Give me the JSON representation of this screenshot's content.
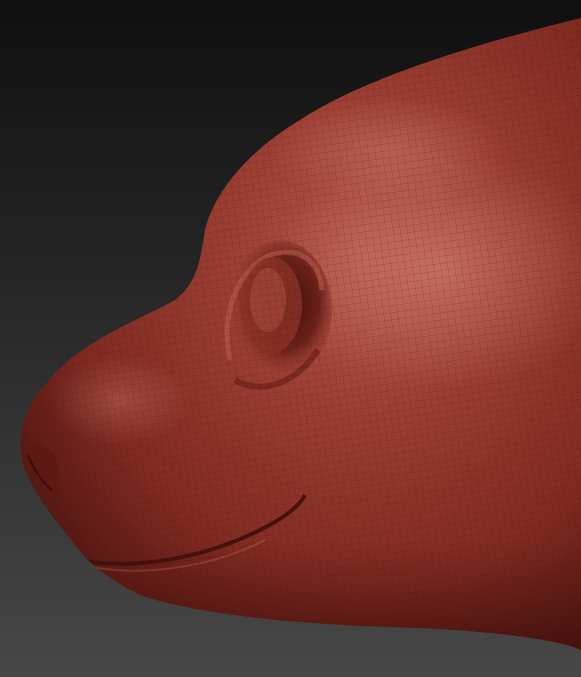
{
  "viewport": {
    "background_top": "#0f0f0f",
    "background_bottom": "#474747",
    "material_base": "#8a2f26",
    "material_highlight": "#c46a5e",
    "material_shadow": "#4a140f",
    "wireframe_color": "#5a1a14"
  },
  "model": {
    "subject": "animal-head-sculpt",
    "view": "side-profile-left",
    "polyframe": true
  }
}
